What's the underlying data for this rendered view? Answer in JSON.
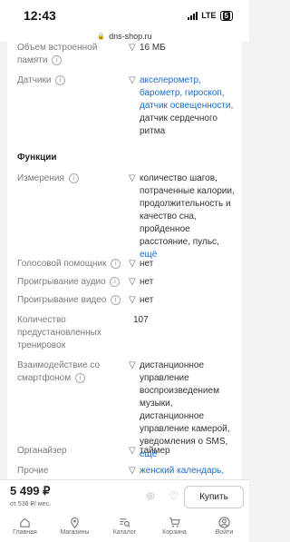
{
  "status": {
    "time": "12:43",
    "network": "LTE",
    "battery": "5"
  },
  "url": "dns-shop.ru",
  "specs": {
    "memory": {
      "label": "Объем встроенной памяти",
      "value": "16 МБ"
    },
    "sensors": {
      "label": "Датчики",
      "links": "акселерометр, барометр, гироскоп, датчик освещенности,",
      "extra": "датчик сердечного ритма"
    },
    "section_functions": "Функции",
    "measurements": {
      "label": "Измерения",
      "value": "количество шагов, потраченные калории, продолжительность и качество сна, пройденное расстояние, пульс,",
      "more": "ещё"
    },
    "voice": {
      "label": "Голосовой помощник",
      "value": "нет"
    },
    "audio": {
      "label": "Проигрывание аудио",
      "value": "нет"
    },
    "video": {
      "label": "Проигрывание видео",
      "value": "нет"
    },
    "workouts": {
      "label": "Количество предустановленных тренировок",
      "value": "107"
    },
    "phone": {
      "label": "Взаимодействие со смартфоном",
      "value": "дистанционное управление воспроизведением музыки, дистанционное управление камерой, уведомления о SMS,",
      "more": "ещё"
    },
    "organizer": {
      "label": "Органайзер",
      "value": "таймер"
    },
    "other": {
      "label": "Прочие функциональные",
      "value": "женский календарь,"
    }
  },
  "buy": {
    "price": "5 499 ₽",
    "credit": "от 536 ₽/ мес.",
    "button": "Купить"
  },
  "tabs": [
    {
      "label": "Главная",
      "icon": "home-icon"
    },
    {
      "label": "Магазины",
      "icon": "location-pin-icon"
    },
    {
      "label": "Каталог",
      "icon": "catalog-search-icon"
    },
    {
      "label": "Корзина",
      "icon": "cart-icon"
    },
    {
      "label": "Войти",
      "icon": "user-icon"
    }
  ]
}
